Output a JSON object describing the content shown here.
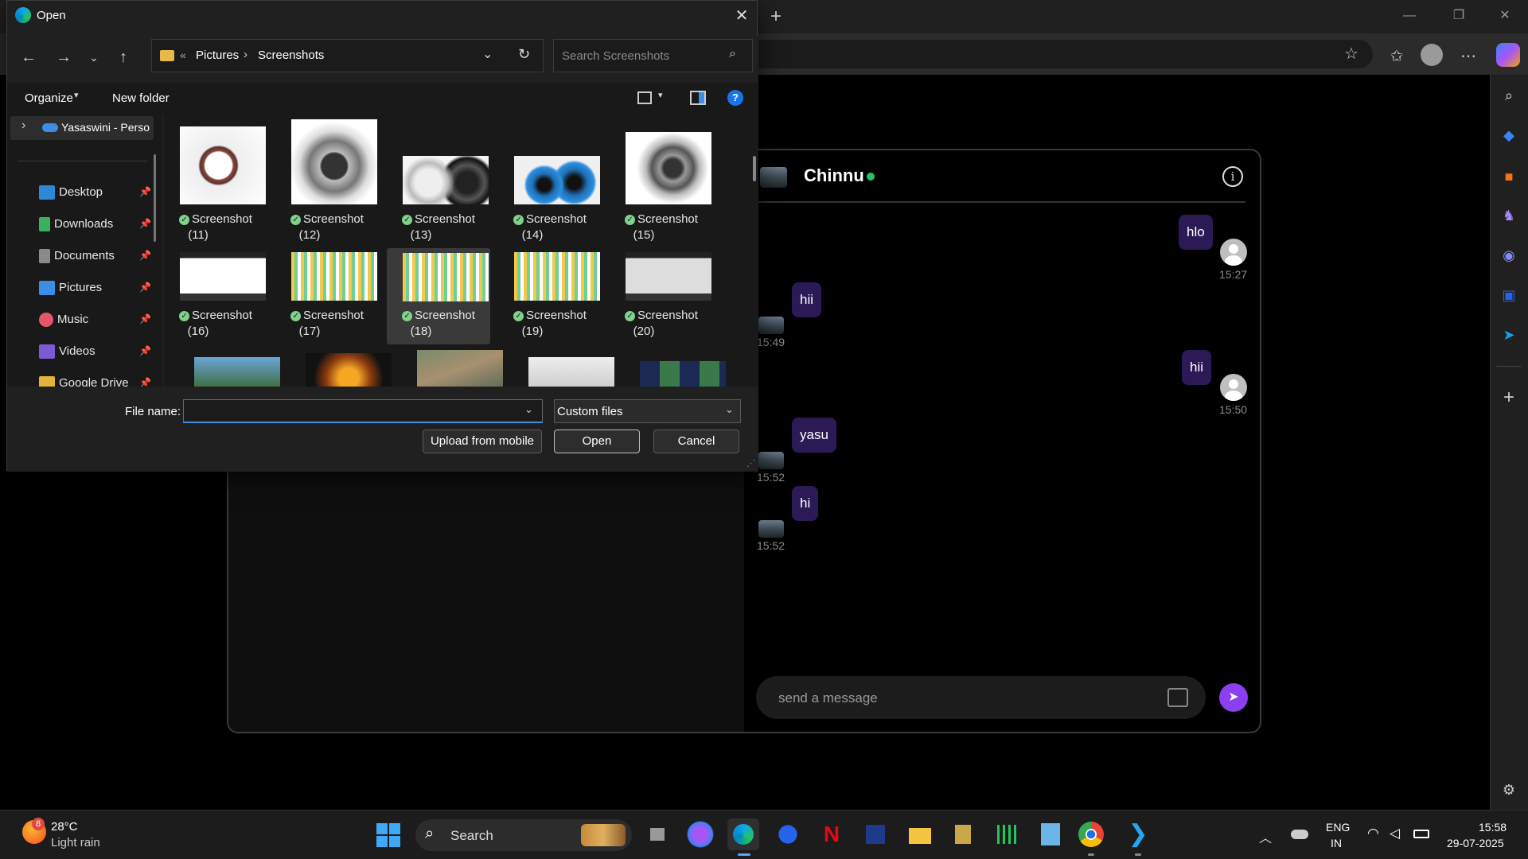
{
  "dialog": {
    "title": "Open",
    "path": [
      "Pictures",
      "Screenshots"
    ],
    "path_prefix": "«",
    "search_placeholder": "Search Screenshots",
    "toolbar": {
      "organize": "Organize",
      "new_folder": "New folder"
    },
    "nav": {
      "cloud": "Yasaswini - Perso",
      "items": [
        {
          "label": "Desktop",
          "color": "#2e88d8"
        },
        {
          "label": "Downloads",
          "color": "#3ab25b"
        },
        {
          "label": "Documents",
          "color": "#8a8a8a"
        },
        {
          "label": "Pictures",
          "color": "#3a8ee6"
        },
        {
          "label": "Music",
          "color": "#e5566a"
        },
        {
          "label": "Videos",
          "color": "#7a5bd6"
        },
        {
          "label": "Google Drive",
          "color": "#e0b53a"
        }
      ]
    },
    "files": [
      {
        "name": "Screenshot",
        "num": "(11)"
      },
      {
        "name": "Screenshot",
        "num": "(12)"
      },
      {
        "name": "Screenshot",
        "num": "(13)"
      },
      {
        "name": "Screenshot",
        "num": "(14)"
      },
      {
        "name": "Screenshot",
        "num": "(15)"
      },
      {
        "name": "Screenshot",
        "num": "(16)"
      },
      {
        "name": "Screenshot",
        "num": "(17)"
      },
      {
        "name": "Screenshot",
        "num": "(18)"
      },
      {
        "name": "Screenshot",
        "num": "(19)"
      },
      {
        "name": "Screenshot",
        "num": "(20)"
      }
    ],
    "filename_label": "File name:",
    "filename_value": "",
    "filetype": "Custom files",
    "buttons": {
      "upload": "Upload from mobile",
      "open": "Open",
      "cancel": "Cancel"
    }
  },
  "chat": {
    "contact": "Chinnu",
    "status_color": "#22c55e",
    "messages": [
      {
        "text": "hlo",
        "time": "15:27",
        "side": "right"
      },
      {
        "text": "hii",
        "time": "15:49",
        "side": "left"
      },
      {
        "text": "hii",
        "time": "15:50",
        "side": "right"
      },
      {
        "text": "yasu",
        "time": "15:52",
        "side": "left"
      },
      {
        "text": "hi",
        "time": "15:52",
        "side": "left"
      }
    ],
    "input_placeholder": "send a message",
    "accent": "#8a3ff0"
  },
  "taskbar": {
    "weather_badge": "8",
    "temp": "28°C",
    "condition": "Light rain",
    "search_label": "Search",
    "lang_top": "ENG",
    "lang_bottom": "IN",
    "time": "15:58",
    "date": "29-07-2025"
  }
}
